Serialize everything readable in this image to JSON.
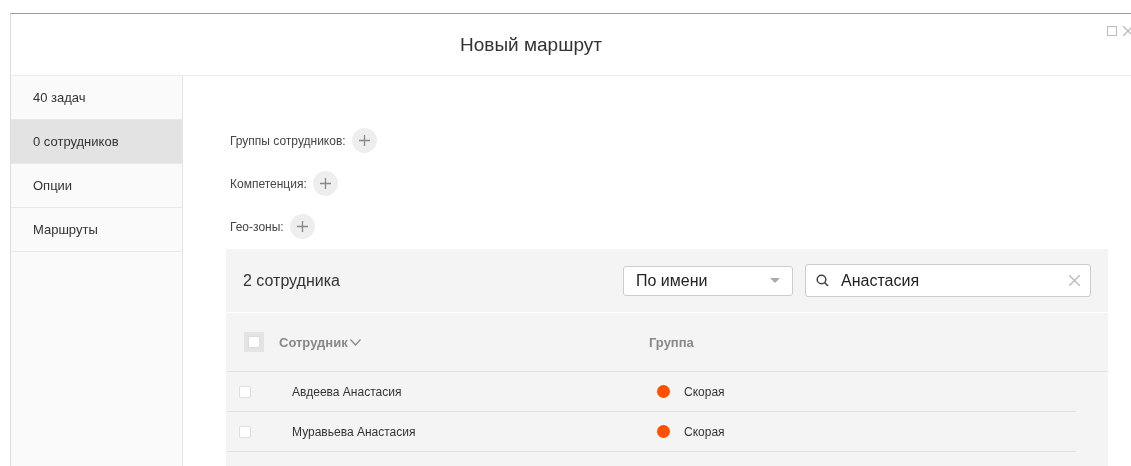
{
  "window": {
    "title": "Новый маршрут"
  },
  "sidebar": {
    "items": [
      {
        "label": "40 задач",
        "selected": false
      },
      {
        "label": "0 сотрудников",
        "selected": true
      },
      {
        "label": "Опции",
        "selected": false
      },
      {
        "label": "Маршруты",
        "selected": false
      }
    ]
  },
  "filters": [
    {
      "label": "Группы сотрудников:"
    },
    {
      "label": "Компетенция:"
    },
    {
      "label": "Гео-зоны:"
    }
  ],
  "panel": {
    "count": "2 сотрудника",
    "sort": {
      "value": "По имени"
    },
    "search": {
      "value": "Анастасия"
    }
  },
  "table": {
    "select_all": {
      "checked": false
    },
    "columns": [
      "Сотрудник",
      "Группа"
    ],
    "rows": [
      {
        "checked": false,
        "name": "Авдеева Анастасия",
        "group": "Скорая",
        "color": "#ff5000"
      },
      {
        "checked": false,
        "name": "Муравьева Анастасия",
        "group": "Скорая",
        "color": "#ff5000"
      }
    ]
  }
}
